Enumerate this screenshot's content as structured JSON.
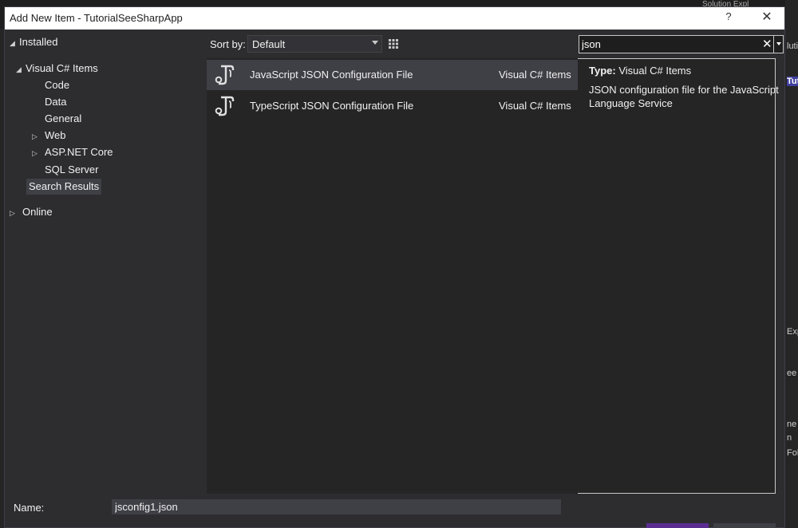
{
  "window": {
    "title": "Add New Item - TutorialSeeSharpApp",
    "help_label": "?",
    "close_label": "✕"
  },
  "background_fragments": {
    "top_right": "Solution Expl",
    "right": [
      "lutio",
      "Tut",
      "Exp",
      "ee",
      "ne",
      "n",
      "Fol"
    ]
  },
  "tree": {
    "installed": "Installed",
    "visual_csharp": "Visual C# Items",
    "code": "Code",
    "data": "Data",
    "general": "General",
    "web": "Web",
    "aspnet": "ASP.NET Core",
    "sql": "SQL Server",
    "search_results": "Search Results",
    "online": "Online"
  },
  "toolbar": {
    "sort_label": "Sort by:",
    "sort_value": "Default"
  },
  "search": {
    "value": "json"
  },
  "templates": [
    {
      "name": "JavaScript JSON Configuration File",
      "type": "Visual C# Items",
      "icon": "json-config-icon",
      "selected": true
    },
    {
      "name": "TypeScript JSON Configuration File",
      "type": "Visual C# Items",
      "icon": "json-config-icon",
      "selected": false
    }
  ],
  "details": {
    "type_label": "Type:",
    "type_value": "Visual C# Items",
    "description": "JSON configuration file for the JavaScript Language Service"
  },
  "bottom": {
    "name_label": "Name:",
    "name_value": "jsconfig1.json"
  },
  "colors": {
    "dialog_bg": "#2d2d30",
    "list_bg": "#252526",
    "selected_bg": "#3f3f46",
    "accent": "#5c2d91",
    "text": "#f1f1f1"
  }
}
